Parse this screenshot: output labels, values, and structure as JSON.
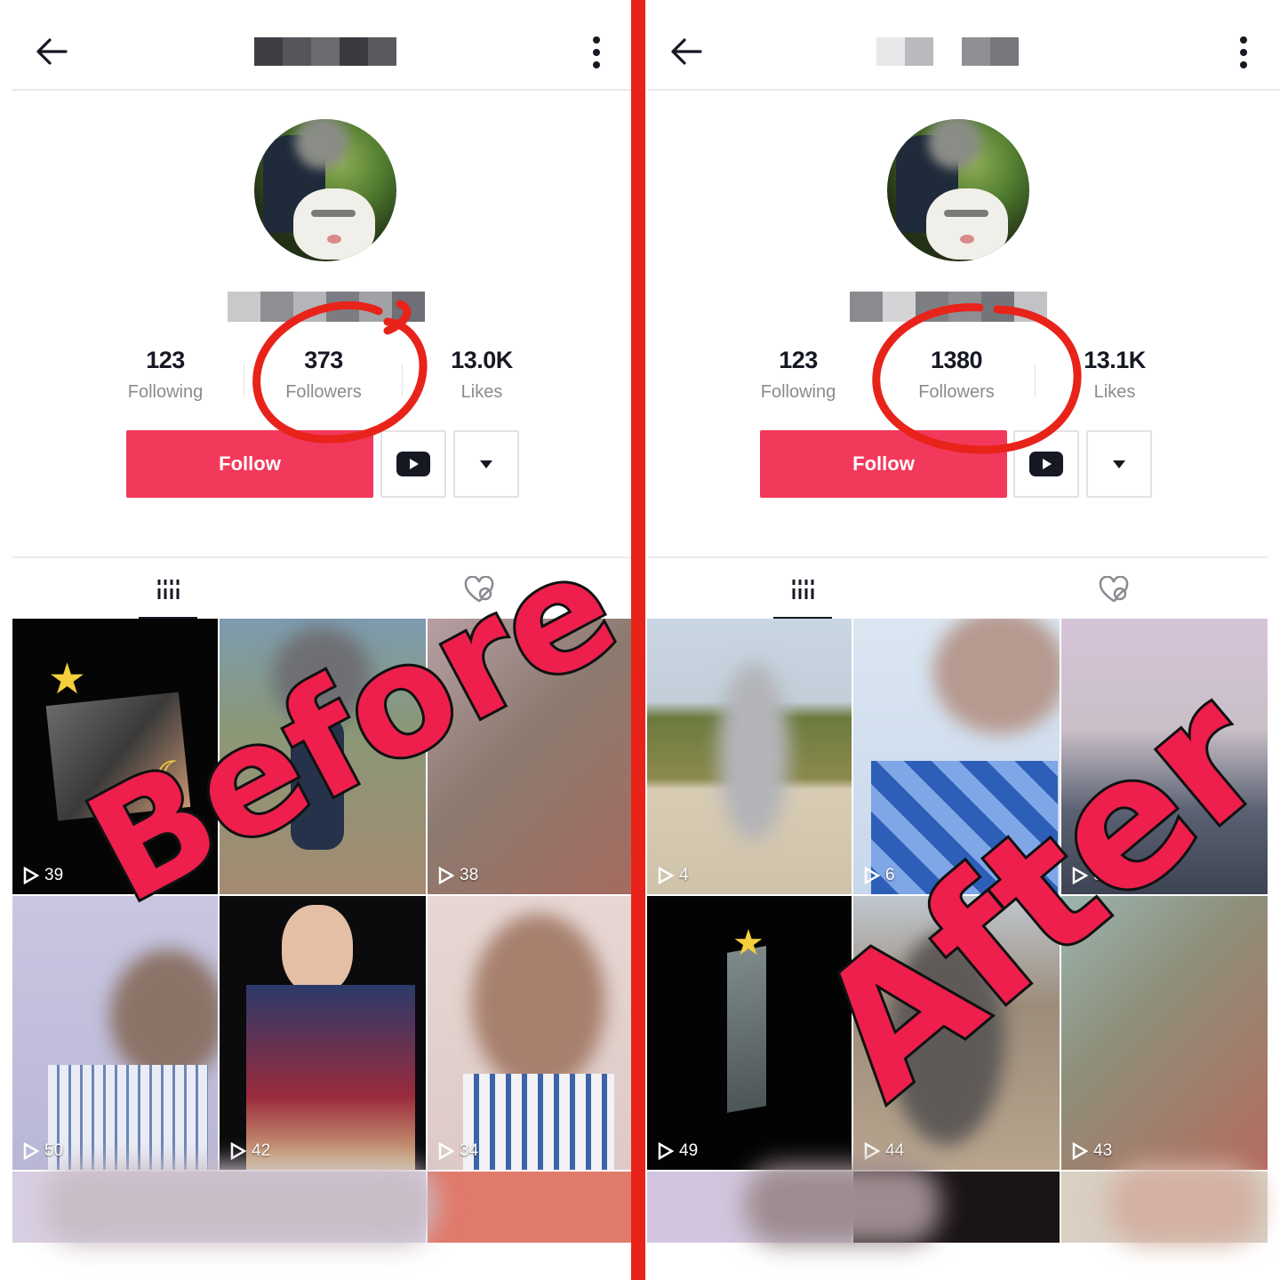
{
  "panels": {
    "before": {
      "stats": {
        "following": {
          "value": "123",
          "label": "Following"
        },
        "followers": {
          "value": "373",
          "label": "Followers"
        },
        "likes": {
          "value": "13.0K",
          "label": "Likes"
        }
      },
      "follow_label": "Follow",
      "videos": [
        {
          "views": "39"
        },
        {
          "views": ""
        },
        {
          "views": "38"
        },
        {
          "views": "50"
        },
        {
          "views": "42"
        },
        {
          "views": "34"
        }
      ]
    },
    "after": {
      "stats": {
        "following": {
          "value": "123",
          "label": "Following"
        },
        "followers": {
          "value": "1380",
          "label": "Followers"
        },
        "likes": {
          "value": "13.1K",
          "label": "Likes"
        }
      },
      "follow_label": "Follow",
      "videos": [
        {
          "views": "4"
        },
        {
          "views": "6"
        },
        {
          "views": "51"
        },
        {
          "views": "49"
        },
        {
          "views": "44"
        },
        {
          "views": "43"
        }
      ]
    }
  },
  "overlay": {
    "before": "Before",
    "after": "After"
  },
  "colors": {
    "follow_button": "#f2395b",
    "annotation": "#e8231a",
    "divider": "#e8231a",
    "overlay_fill": "#ee1f4d"
  },
  "icons": [
    "back-arrow-icon",
    "more-vertical-icon",
    "youtube-icon",
    "dropdown-caret-icon",
    "videos-grid-icon",
    "liked-heart-icon",
    "play-icon"
  ]
}
